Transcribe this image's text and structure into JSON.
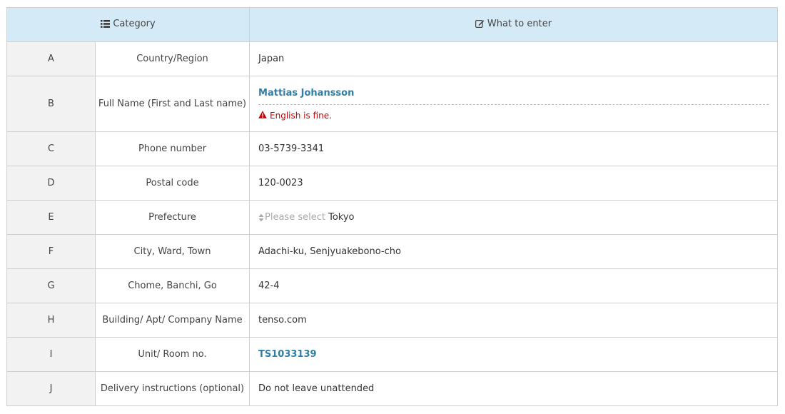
{
  "header": {
    "category_label": "Category",
    "category_icon": "list-icon",
    "enter_label": "What to enter",
    "enter_icon": "edit-icon",
    "bg_color": "#d4ebf7"
  },
  "rows": [
    {
      "letter": "A",
      "category": "Country/Region",
      "value": "Japan"
    },
    {
      "letter": "B",
      "category": "Full Name (First and Last name)",
      "value": "Mattias Johansson",
      "note": "English is fine.",
      "note_icon": "warning-icon"
    },
    {
      "letter": "C",
      "category": "Phone number",
      "value": "03-5739-3341"
    },
    {
      "letter": "D",
      "category": "Postal code",
      "value": "120-0023"
    },
    {
      "letter": "E",
      "category": "Prefecture",
      "placeholder": "Please select",
      "value": "Tokyo"
    },
    {
      "letter": "F",
      "category": "City, Ward, Town",
      "value": "Adachi-ku, Senjyuakebono-cho"
    },
    {
      "letter": "G",
      "category": "Chome, Banchi, Go",
      "value": "42-4"
    },
    {
      "letter": "H",
      "category": "Building/ Apt/ Company Name",
      "value": "tenso.com"
    },
    {
      "letter": "I",
      "category": "Unit/ Room no.",
      "value": "TS1033139"
    },
    {
      "letter": "J",
      "category": "Delivery instructions (optional)",
      "value": "Do not leave unattended"
    }
  ],
  "colors": {
    "highlight": "#2e7ea8",
    "warning": "#cc0000",
    "letter_bg": "#f2f2f2"
  }
}
